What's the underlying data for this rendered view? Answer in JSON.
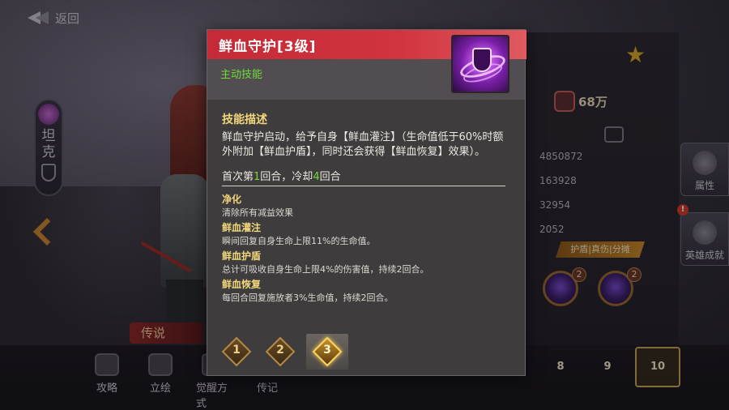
{
  "background": {
    "back_label": "返回",
    "role_label": "坦克",
    "legend_label": "传说",
    "power": "68万",
    "stats": [
      "4850872",
      "163928",
      "32954",
      "2052"
    ],
    "orange_tab": "护盾|真伤|分摊",
    "orb_levels": [
      "2",
      "2"
    ],
    "side_buttons": [
      "属性",
      "英雄成就"
    ],
    "alert_badge": "!",
    "bottom_nav": [
      "攻略",
      "立绘",
      "觉醒方式",
      "传记"
    ],
    "star_levels": [
      "8",
      "9",
      "10"
    ]
  },
  "popup": {
    "title": "鲜血守护[3级]",
    "skill_type": "主动技能",
    "section_title": "技能描述",
    "description": "鲜血守护启动，给予自身【鲜血灌注】（生命值低于60%时额外附加【鲜血护盾】，同时还会获得【鲜血恢复】效果）。",
    "cooldown": {
      "prefix": "首次第",
      "first_turn": "1",
      "middle": "回合，冷却",
      "cd_turns": "4",
      "suffix": "回合"
    },
    "effects": [
      {
        "name": "净化",
        "desc": "清除所有减益效果"
      },
      {
        "name": "鲜血灌注",
        "desc": "瞬间回复自身生命上限11%的生命值。"
      },
      {
        "name": "鲜血护盾",
        "desc": "总计可吸收自身生命上限4%的伤害值，持续2回合。"
      },
      {
        "name": "鲜血恢复",
        "desc": "每回合回复施放者3%生命值，持续2回合。"
      }
    ],
    "levels": [
      "1",
      "2",
      "3"
    ],
    "selected_level": "3"
  },
  "colors": {
    "title_bar": "#c52a37",
    "skill_type": "#6fdc3a",
    "heading": "#f1d77a",
    "level_active": "#ffd35a"
  }
}
